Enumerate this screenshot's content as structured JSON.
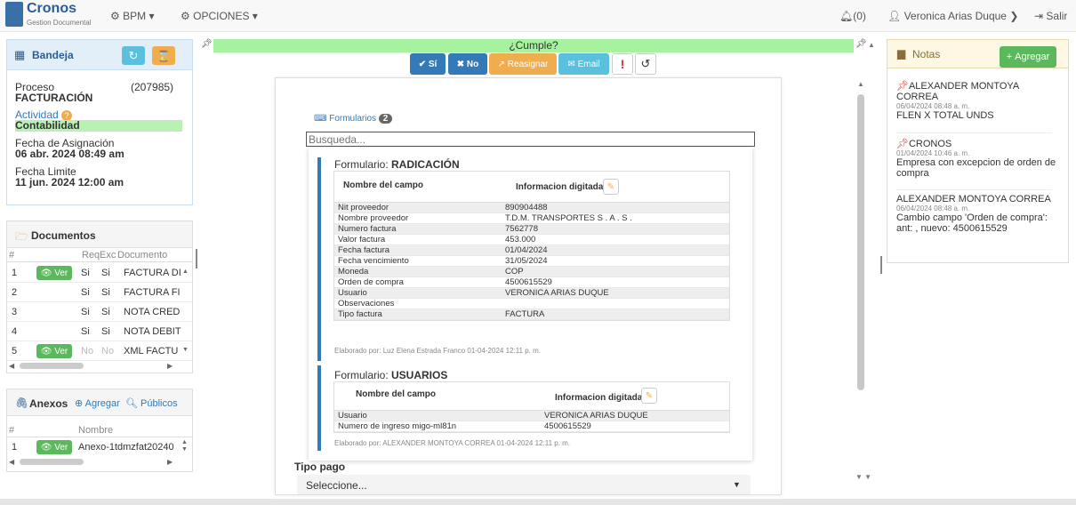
{
  "app": {
    "name": "Cronos",
    "subtitle": "Gestion Documental"
  },
  "nav": {
    "bpm": "BPM",
    "opciones": "OPCIONES",
    "notifications": "(0)",
    "user": "Veronica Arias Duque",
    "logout": "Salir"
  },
  "bandeja": {
    "title": "Bandeja",
    "proceso_label": "Proceso",
    "proceso_value": "FACTURACIÓN",
    "proceso_id": "(207985)",
    "actividad_label": "Actividad",
    "actividad_value": "Contabilidad",
    "asignacion_label": "Fecha de Asignación",
    "asignacion_value": "06 abr. 2024 08:49 am",
    "limite_label": "Fecha Limite",
    "limite_value": "11 jun. 2024 12:00 am"
  },
  "documentos": {
    "title": "Documentos",
    "headers": [
      "#",
      "",
      "Req",
      "Exc",
      "Documento"
    ],
    "view_label": "Ver",
    "rows": [
      {
        "n": "1",
        "ver": true,
        "req": "Si",
        "exc": "Si",
        "doc": "FACTURA DI"
      },
      {
        "n": "2",
        "ver": false,
        "req": "Si",
        "exc": "Si",
        "doc": "FACTURA FI"
      },
      {
        "n": "3",
        "ver": false,
        "req": "Si",
        "exc": "Si",
        "doc": "NOTA CRED"
      },
      {
        "n": "4",
        "ver": false,
        "req": "Si",
        "exc": "Si",
        "doc": "NOTA DEBIT"
      },
      {
        "n": "5",
        "ver": true,
        "req": "No",
        "exc": "No",
        "doc": "XML FACTU"
      }
    ]
  },
  "anexos": {
    "title": "Anexos",
    "add": "Agregar",
    "public": "Públicos",
    "headers": [
      "#",
      "",
      "Nombre"
    ],
    "view_label": "Ver",
    "rows": [
      {
        "n": "1",
        "name": "Anexo-1tdmzfat20240"
      }
    ]
  },
  "cumple": {
    "title": "¿Cumple?",
    "si": "Sí",
    "no": "No",
    "reasignar": "Reasignar",
    "email": "Email"
  },
  "formularios": {
    "label": "Formularios",
    "count": "2",
    "search_placeholder": "Busqueda...",
    "form1": {
      "prefix": "Formulario: ",
      "name": "RADICACIÓN",
      "col1": "Nombre del campo",
      "col2": "Informacion digitada",
      "rows": [
        [
          "Nit proveedor",
          "890904488"
        ],
        [
          "Nombre proveedor",
          "T.D.M. TRANSPORTES S . A . S ."
        ],
        [
          "Numero factura",
          "7562778"
        ],
        [
          "Valor factura",
          "453.000"
        ],
        [
          "Fecha factura",
          "01/04/2024"
        ],
        [
          "Fecha vencimiento",
          "31/05/2024"
        ],
        [
          "Moneda",
          "COP"
        ],
        [
          "Orden de compra",
          "4500615529"
        ],
        [
          "Usuario",
          "VERONICA ARIAS DUQUE"
        ],
        [
          "Observaciones",
          ""
        ],
        [
          "Tipo factura",
          "FACTURA"
        ]
      ],
      "footer": "Elaborado por: Luz Elena Estrada Franco 01-04-2024 12:11 p. m."
    },
    "form2": {
      "prefix": "Formulario: ",
      "name": "USUARIOS",
      "col1": "Nombre del campo",
      "col2": "Informacion digitada",
      "rows": [
        [
          "Usuario",
          "VERONICA ARIAS DUQUE"
        ],
        [
          "Numero de ingreso migo-ml81n",
          "4500615529"
        ]
      ],
      "footer": "Elaborado por: ALEXANDER MONTOYA CORREA 01-04-2024 12:11 p. m."
    }
  },
  "tipo_pago": {
    "label": "Tipo pago",
    "value": "Seleccione..."
  },
  "notas": {
    "title": "Notas",
    "add": "Agregar",
    "items": [
      {
        "author": "ALEXANDER MONTOYA CORREA",
        "date": "06/04/2024 08:48 a. m.",
        "text": "FLEN X TOTAL UNDS",
        "pinned": true
      },
      {
        "author": "CRONOS",
        "date": "01/04/2024 10:46 a. m.",
        "text": "Empresa con excepcion de orden de compra",
        "pinned": true
      },
      {
        "author": "ALEXANDER MONTOYA CORREA",
        "date": "06/04/2024 08:48 a. m.",
        "text": "Cambio campo 'Orden de compra': ant: , nuevo: 4500615529",
        "pinned": false
      }
    ]
  },
  "colors": {
    "primary": "#337ab7",
    "success": "#5cb85c",
    "warning": "#f0ad4e",
    "info": "#5bc0de",
    "danger": "#d9312b"
  }
}
